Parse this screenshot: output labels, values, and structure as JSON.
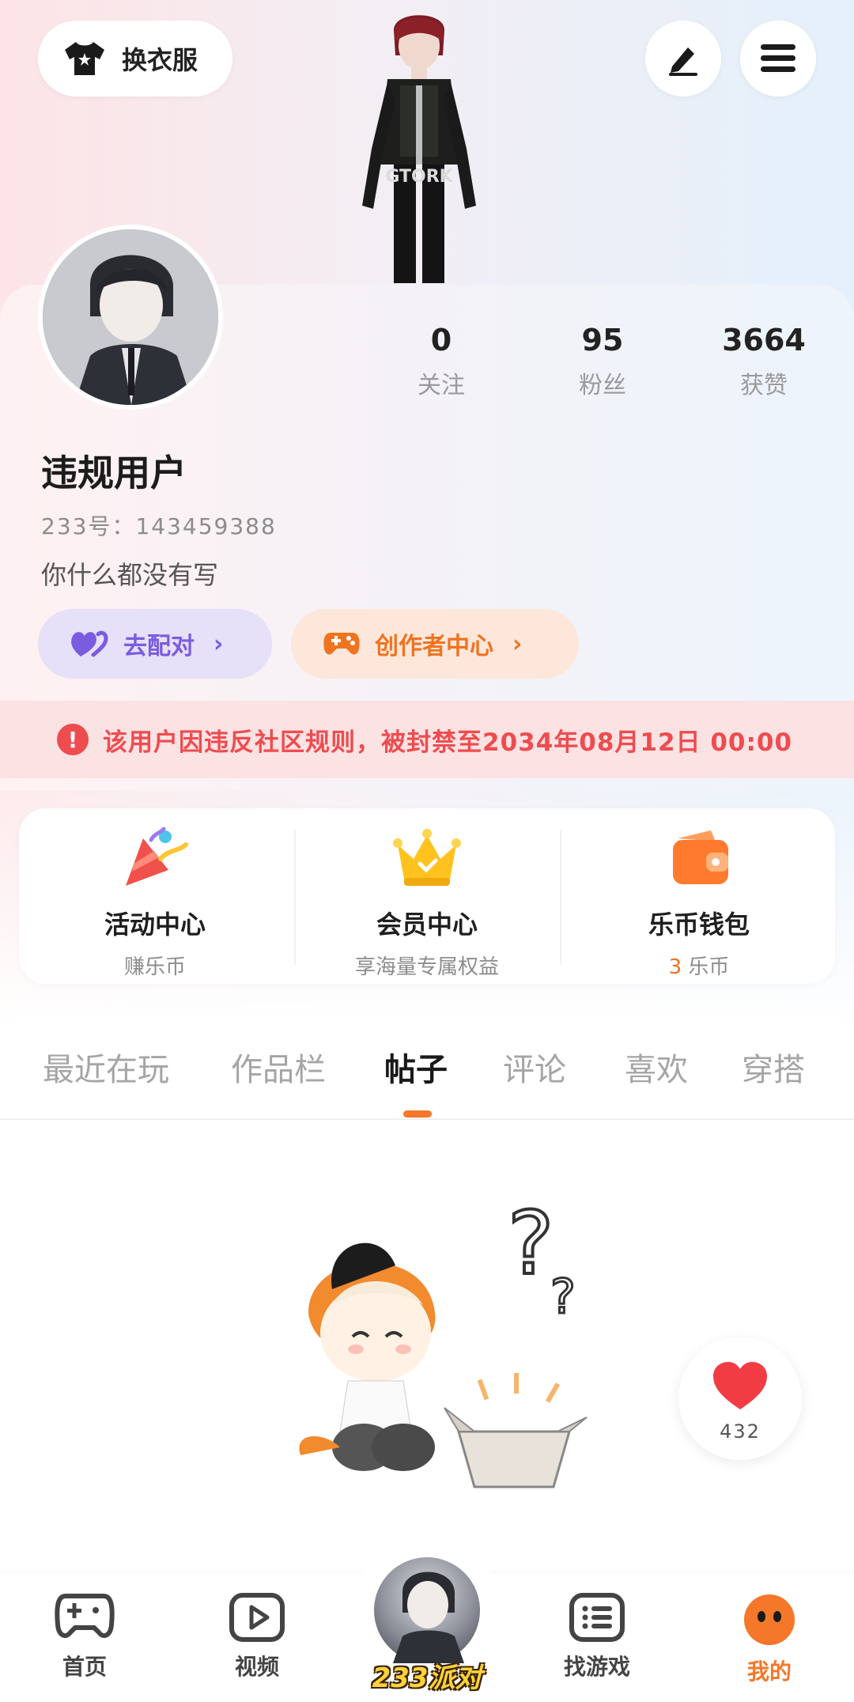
{
  "header": {
    "outfit_label": "换衣服"
  },
  "profile": {
    "stats": [
      {
        "num": "0",
        "label": "关注"
      },
      {
        "num": "95",
        "label": "粉丝"
      },
      {
        "num": "3664",
        "label": "获赞"
      }
    ],
    "username": "违规用户",
    "uid": "233号：143459388",
    "bio": "你什么都没有写",
    "match_label": "去配对",
    "creator_label": "创作者中心"
  },
  "ban_notice": "该用户因违反社区规则，被封禁至2034年08月12日 00:00",
  "features": [
    {
      "title": "活动中心",
      "sub": "赚乐币"
    },
    {
      "title": "会员中心",
      "sub": "享海量专属权益"
    },
    {
      "title": "乐币钱包",
      "sub_value": "3",
      "sub": "乐币"
    }
  ],
  "tabs": [
    "最近在玩",
    "作品栏",
    "帖子",
    "评论",
    "喜欢",
    "穿搭"
  ],
  "active_tab": "帖子",
  "like_count": "432",
  "bottom_nav": {
    "items": [
      {
        "label": "首页"
      },
      {
        "label": "视频"
      },
      {
        "label": "找游戏"
      },
      {
        "label": "我的"
      }
    ],
    "center_label": "233派对"
  },
  "colors": {
    "accent": "#f5772a",
    "warning": "#ee4c4f",
    "match": "#7a5ce0"
  }
}
